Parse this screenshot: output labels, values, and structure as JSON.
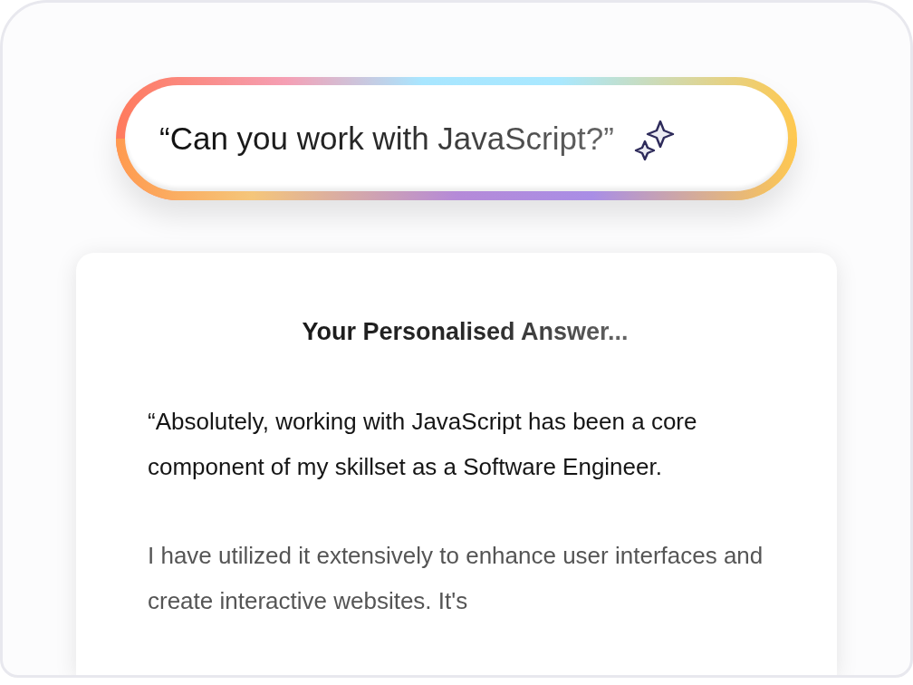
{
  "search": {
    "value": "“Can you work with JavaScript?”"
  },
  "answer": {
    "title": "Your Personalised Answer...",
    "paragraphs": [
      "“Absolutely, working with JavaScript has been a core component of my skillset as a Software Engineer.",
      "I have utilized it extensively to enhance user interfaces and create interactive websites. It's"
    ]
  }
}
